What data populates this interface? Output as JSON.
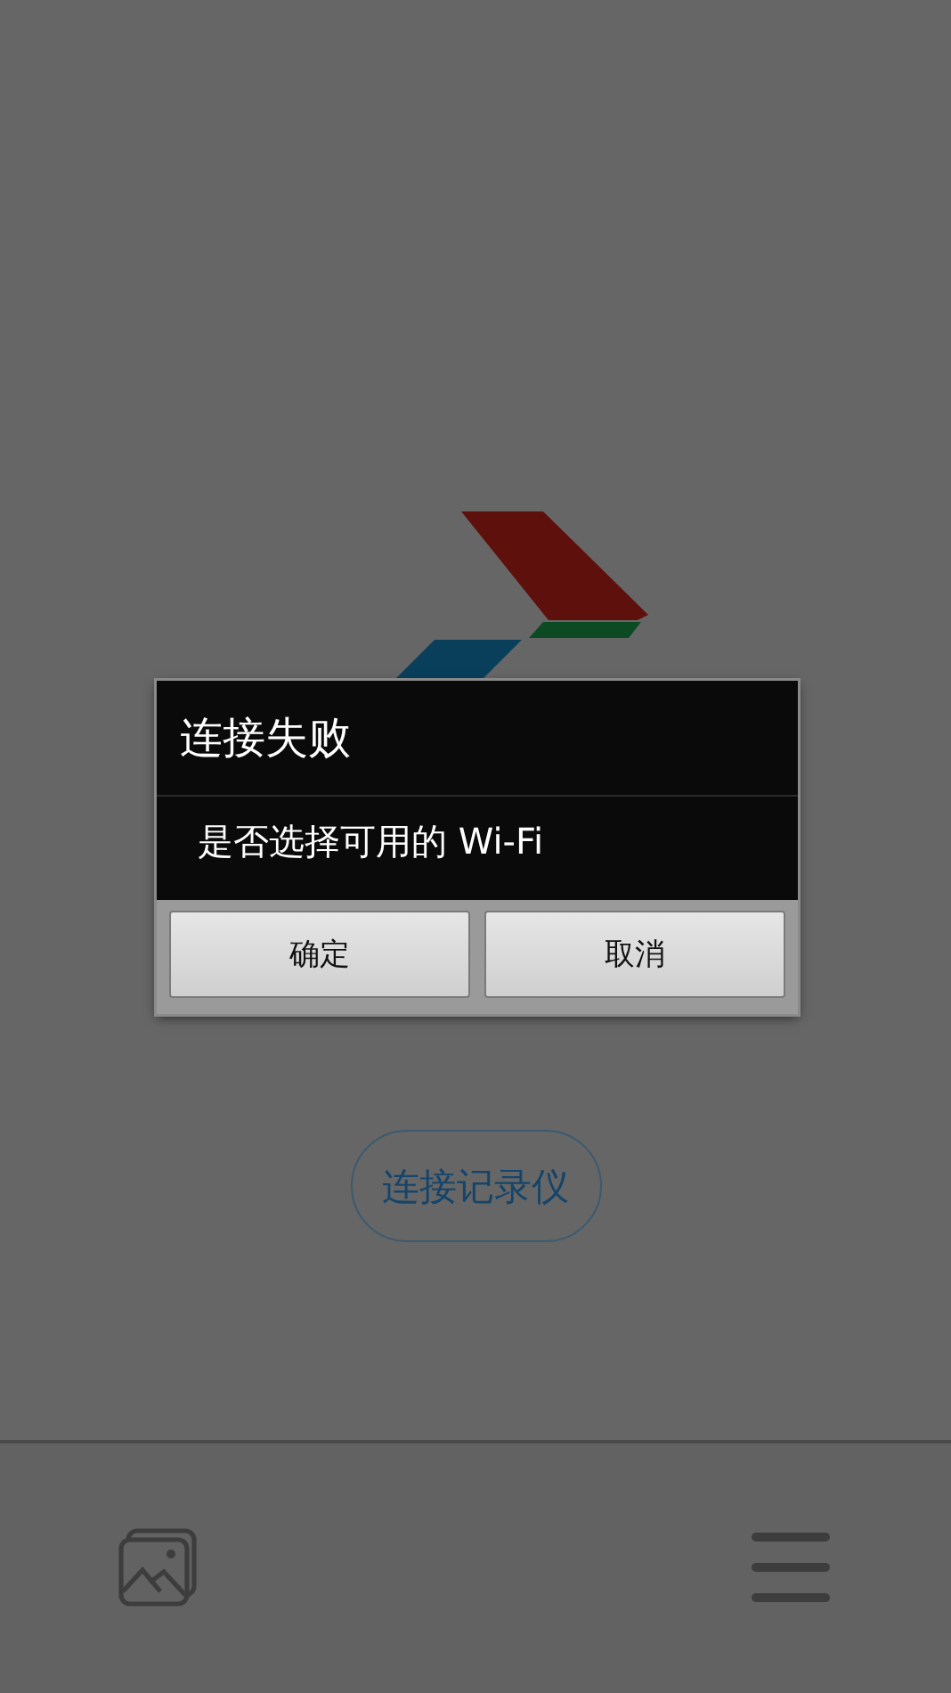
{
  "connect_button": {
    "label": "连接记录仪"
  },
  "dialog": {
    "title": "连接失败",
    "message": "是否选择可用的 Wi-Fi",
    "buttons": [
      {
        "label": "确定"
      },
      {
        "label": "取消"
      }
    ]
  }
}
